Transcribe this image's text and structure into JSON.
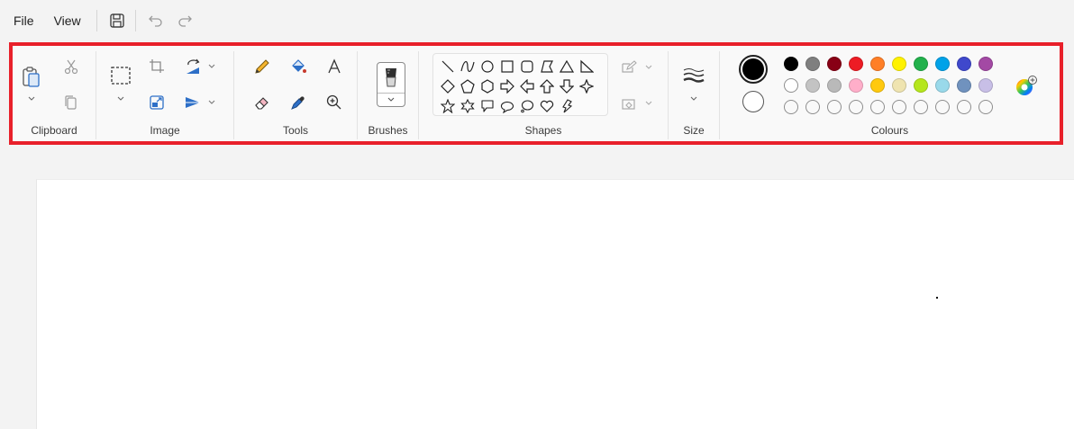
{
  "menu": {
    "file": "File",
    "view": "View"
  },
  "ribbon": {
    "groups": {
      "clipboard": "Clipboard",
      "image": "Image",
      "tools": "Tools",
      "brushes": "Brushes",
      "shapes": "Shapes",
      "size": "Size",
      "colours": "Colours"
    }
  },
  "colors": {
    "highlight_border": "#e8202a",
    "palette_row1": [
      "#000000",
      "#7f7f7f",
      "#880015",
      "#ed1c24",
      "#ff7f27",
      "#fff200",
      "#22b14c",
      "#00a2e8",
      "#3f48cc",
      "#a349a4"
    ],
    "palette_row2": [
      "#ffffff",
      "#c3c3c3",
      "#b9b9b9",
      "#ffaec9",
      "#ffc90e",
      "#efe4b0",
      "#b5e61d",
      "#99d9ea",
      "#7092be",
      "#c8bfe7"
    ],
    "primary": "#000000",
    "secondary": "#ffffff"
  }
}
